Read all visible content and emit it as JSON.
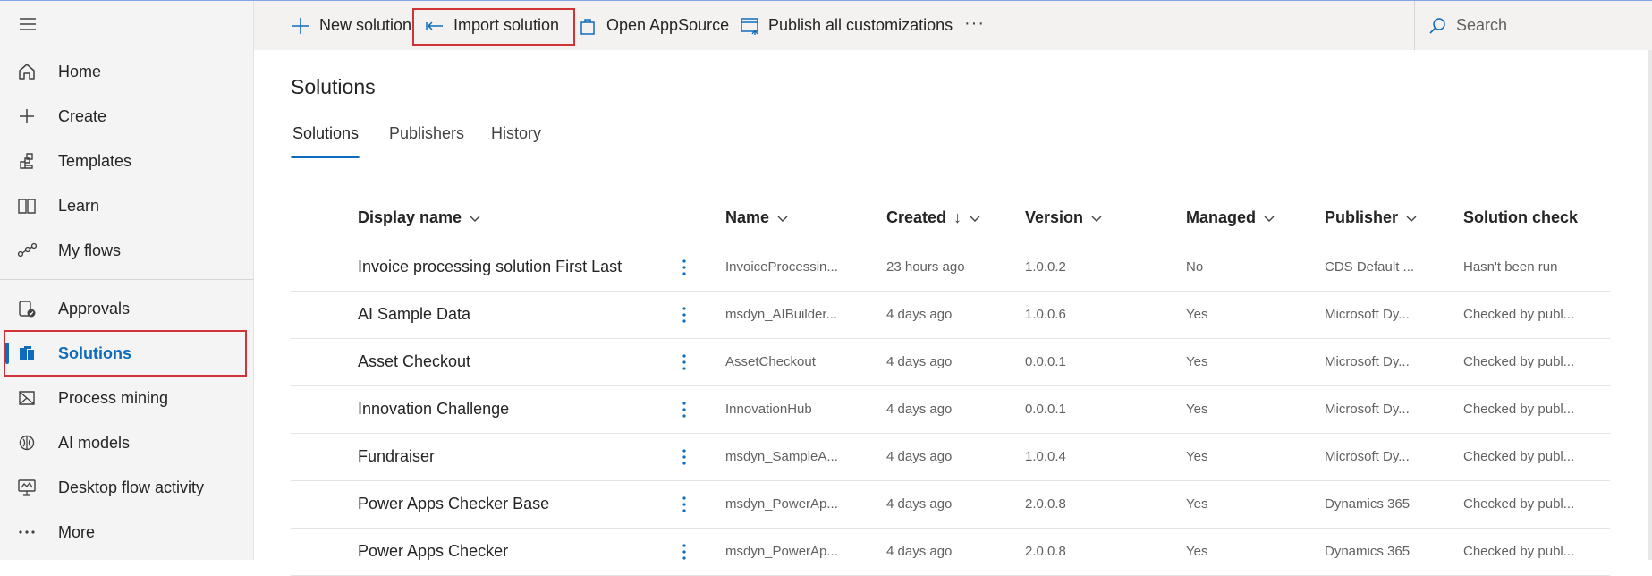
{
  "sidebar": {
    "items": [
      {
        "label": "Home",
        "icon": "home-icon"
      },
      {
        "label": "Create",
        "icon": "plus-icon"
      },
      {
        "label": "Templates",
        "icon": "templates-icon"
      },
      {
        "label": "Learn",
        "icon": "book-icon"
      },
      {
        "label": "My flows",
        "icon": "flows-icon"
      },
      {
        "label": "Approvals",
        "icon": "approvals-icon"
      },
      {
        "label": "Solutions",
        "icon": "solutions-icon",
        "active": true
      },
      {
        "label": "Process mining",
        "icon": "process-mining-icon"
      },
      {
        "label": "AI models",
        "icon": "ai-models-icon"
      },
      {
        "label": "Desktop flow activity",
        "icon": "desktop-flow-icon"
      },
      {
        "label": "More",
        "icon": "more-icon"
      }
    ]
  },
  "toolbar": {
    "new_solution": "New solution",
    "import_solution": "Import solution",
    "open_appsource": "Open AppSource",
    "publish_all": "Publish all customizations",
    "more": "···",
    "search_placeholder": "Search"
  },
  "page": {
    "title": "Solutions",
    "tabs": [
      "Solutions",
      "Publishers",
      "History"
    ]
  },
  "table": {
    "columns": [
      "Display name",
      "Name",
      "Created",
      "Version",
      "Managed",
      "Publisher",
      "Solution check"
    ],
    "sort_arrow": "↓",
    "rows": [
      {
        "display_name": "Invoice processing solution First Last",
        "name": "InvoiceProcessin...",
        "created": "23 hours ago",
        "version": "1.0.0.2",
        "managed": "No",
        "publisher": "CDS Default ...",
        "solution_check": "Hasn't been run"
      },
      {
        "display_name": "AI Sample Data",
        "name": "msdyn_AIBuilder...",
        "created": "4 days ago",
        "version": "1.0.0.6",
        "managed": "Yes",
        "publisher": "Microsoft Dy...",
        "solution_check": "Checked by publ..."
      },
      {
        "display_name": "Asset Checkout",
        "name": "AssetCheckout",
        "created": "4 days ago",
        "version": "0.0.0.1",
        "managed": "Yes",
        "publisher": "Microsoft Dy...",
        "solution_check": "Checked by publ..."
      },
      {
        "display_name": "Innovation Challenge",
        "name": "InnovationHub",
        "created": "4 days ago",
        "version": "0.0.0.1",
        "managed": "Yes",
        "publisher": "Microsoft Dy...",
        "solution_check": "Checked by publ..."
      },
      {
        "display_name": "Fundraiser",
        "name": "msdyn_SampleA...",
        "created": "4 days ago",
        "version": "1.0.0.4",
        "managed": "Yes",
        "publisher": "Microsoft Dy...",
        "solution_check": "Checked by publ..."
      },
      {
        "display_name": "Power Apps Checker Base",
        "name": "msdyn_PowerAp...",
        "created": "4 days ago",
        "version": "2.0.0.8",
        "managed": "Yes",
        "publisher": "Dynamics 365",
        "solution_check": "Checked by publ..."
      },
      {
        "display_name": "Power Apps Checker",
        "name": "msdyn_PowerAp...",
        "created": "4 days ago",
        "version": "2.0.0.8",
        "managed": "Yes",
        "publisher": "Dynamics 365",
        "solution_check": "Checked by publ..."
      }
    ]
  },
  "colors": {
    "accent": "#0f6cbd",
    "highlight_box": "#d13438"
  }
}
